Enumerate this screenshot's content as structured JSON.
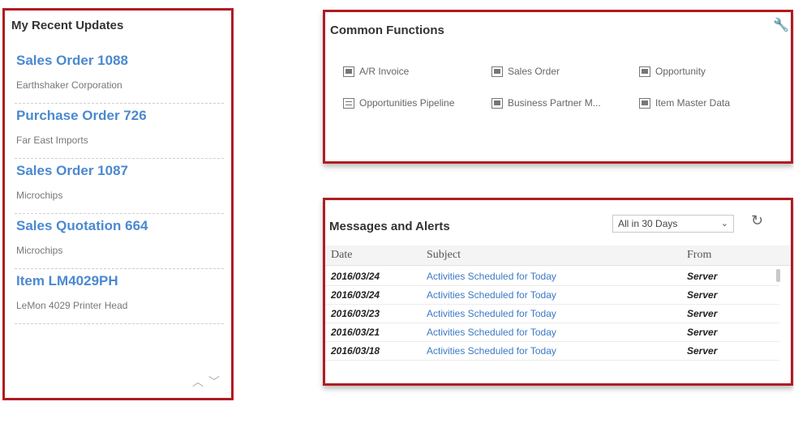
{
  "recent": {
    "title": "My Recent Updates",
    "items": [
      {
        "name": "Sales Order 1088",
        "sub": "Earthshaker Corporation"
      },
      {
        "name": "Purchase Order 726",
        "sub": "Far East Imports"
      },
      {
        "name": "Sales Order 1087",
        "sub": "Microchips"
      },
      {
        "name": "Sales Quotation 664",
        "sub": "Microchips"
      },
      {
        "name": "Item LM4029PH",
        "sub": "LeMon 4029 Printer Head"
      }
    ],
    "nav": {
      "up": "︿",
      "down": "﹀"
    }
  },
  "common": {
    "title": "Common Functions",
    "wrench_icon": "wrench-icon",
    "functions": [
      {
        "label": "A/R Invoice",
        "icon": "form-icon"
      },
      {
        "label": "Sales Order",
        "icon": "form-icon"
      },
      {
        "label": "Opportunity",
        "icon": "form-icon"
      },
      {
        "label": "Opportunities Pipeline",
        "icon": "report-icon"
      },
      {
        "label": "Business Partner M...",
        "icon": "form-icon"
      },
      {
        "label": "Item Master Data",
        "icon": "form-icon"
      }
    ]
  },
  "messages": {
    "title": "Messages and Alerts",
    "filter": "All in 30 Days",
    "refresh_icon": "refresh-icon",
    "columns": [
      "Date",
      "Subject",
      "From"
    ],
    "rows": [
      {
        "date": "2016/03/24",
        "subject": "Activities Scheduled for Today",
        "from": "Server"
      },
      {
        "date": "2016/03/24",
        "subject": "Activities Scheduled for Today",
        "from": "Server"
      },
      {
        "date": "2016/03/23",
        "subject": "Activities Scheduled for Today",
        "from": "Server"
      },
      {
        "date": "2016/03/21",
        "subject": "Activities Scheduled for Today",
        "from": "Server"
      },
      {
        "date": "2016/03/18",
        "subject": "Activities Scheduled for Today",
        "from": "Server"
      }
    ]
  },
  "colors": {
    "border": "#b01c22",
    "link": "#4b89d0"
  }
}
